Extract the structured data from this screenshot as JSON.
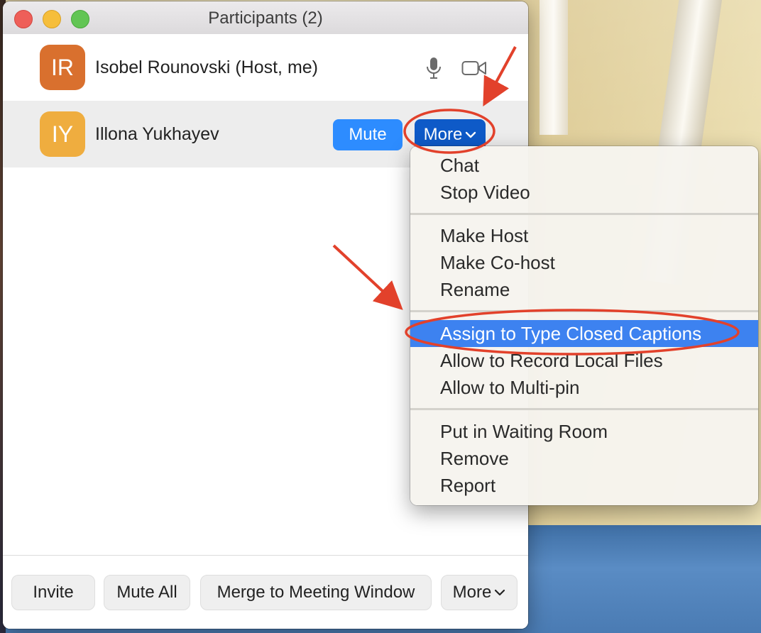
{
  "window": {
    "title": "Participants (2)"
  },
  "participants": [
    {
      "initials": "IR",
      "name": "Isobel Rounovski (Host, me)",
      "avatar_color": "#d9702e"
    },
    {
      "initials": "IY",
      "name": "Illona Yukhayev",
      "avatar_color": "#efad3f"
    }
  ],
  "row_actions": {
    "mute_label": "Mute",
    "more_label": "More"
  },
  "menu": {
    "items": [
      "Chat",
      "Stop Video",
      "Make Host",
      "Make Co-host",
      "Rename",
      "Assign to Type Closed Captions",
      "Allow to Record Local Files",
      "Allow to Multi-pin",
      "Put in Waiting Room",
      "Remove",
      "Report"
    ],
    "highlighted": "Assign to Type Closed Captions"
  },
  "footer": {
    "invite_label": "Invite",
    "mute_all_label": "Mute All",
    "merge_label": "Merge to Meeting Window",
    "more_label": "More"
  },
  "colors": {
    "accent": "#2d8cff",
    "more_button": "#0e5ac8",
    "menu_highlight": "#3d82f0",
    "annotation": "#e2412b"
  },
  "icons": [
    "microphone-icon",
    "video-camera-icon",
    "chevron-down-icon"
  ]
}
